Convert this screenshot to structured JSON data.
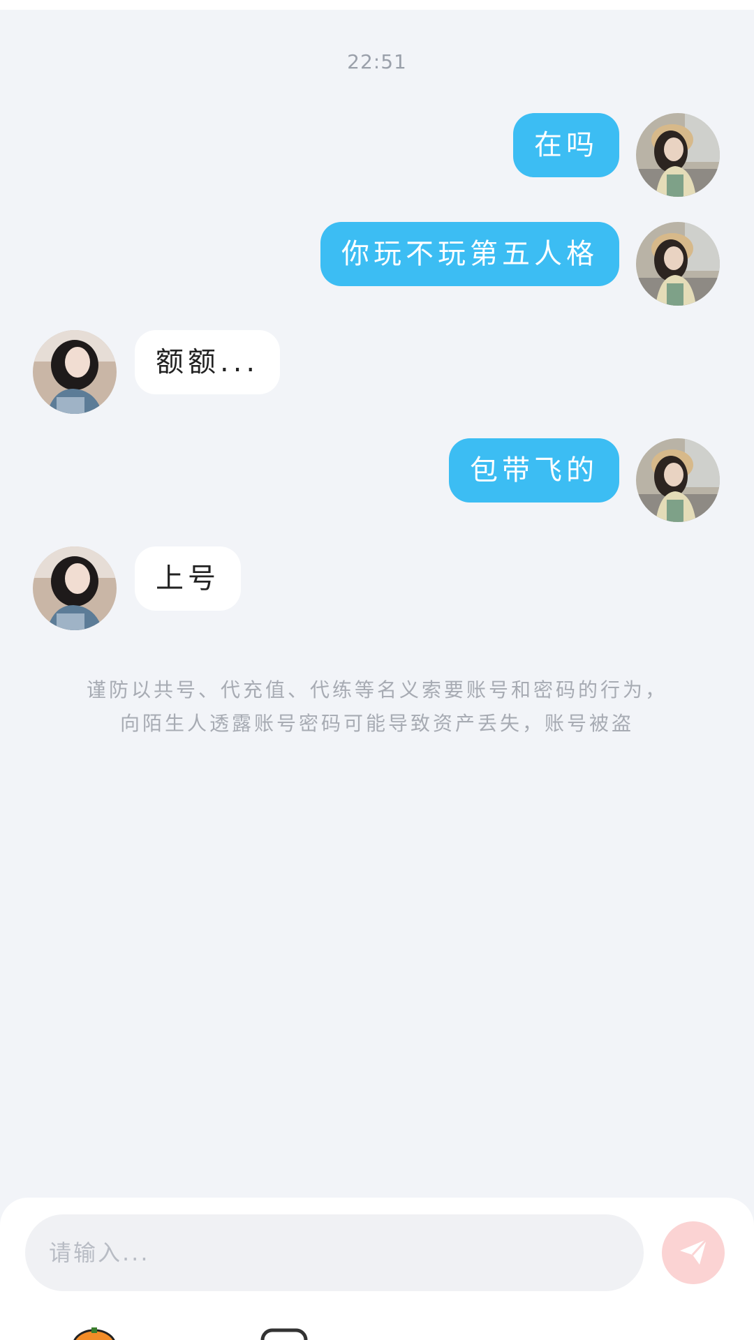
{
  "chat": {
    "timestamp": "22:51",
    "messages": [
      {
        "side": "out",
        "text": "在吗"
      },
      {
        "side": "out",
        "text": "你玩不玩第五人格"
      },
      {
        "side": "in",
        "text": "额额..."
      },
      {
        "side": "out",
        "text": "包带飞的"
      },
      {
        "side": "in",
        "text": "上号"
      }
    ],
    "notice_line1": "谨防以共号、代充值、代练等名义索要账号和密码的行为，",
    "notice_line2": "向陌生人透露账号密码可能导致资产丢失，账号被盗"
  },
  "composer": {
    "placeholder": "请输入...",
    "send_icon": "paper-plane-icon",
    "toolbar_icons": [
      "pumpkin-emoji-icon",
      "gamepad-icon"
    ]
  },
  "colors": {
    "background": "#f2f4f8",
    "outgoing_bubble": "#3cbdf3",
    "incoming_bubble": "#ffffff",
    "send_button": "#fbd3d3"
  }
}
